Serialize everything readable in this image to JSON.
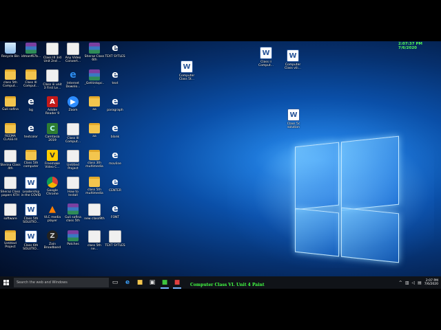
{
  "overlay_clock": "2:07:37 PM 7/6/2020",
  "taskbar": {
    "search_placeholder": "Search the web and Windows",
    "video_title": "Computer Class VI. Unit 4 Paint",
    "clock_time": "2:07 PM",
    "clock_date": "7/6/2020"
  },
  "icons": [
    {
      "label": "Recycle Bin",
      "type": "bin"
    },
    {
      "label": "idmanf67b...",
      "type": "rar"
    },
    {
      "label": "Class III 3rd Unit 2nd ...",
      "type": "file"
    },
    {
      "label": "Any Video Convert...",
      "type": "file"
    },
    {
      "label": "Sheraz Class 6th",
      "type": "rar"
    },
    {
      "label": "TEXT SYTLES",
      "type": "edge"
    },
    {
      "label": "class 5th Comput...",
      "type": "folder"
    },
    {
      "label": "Class III Comput...",
      "type": "folder"
    },
    {
      "label": "Class iii unit 3 First Le...",
      "type": "file"
    },
    {
      "label": "Internet Downlo...",
      "type": "ie"
    },
    {
      "label": "_Gettintopc...",
      "type": "rar"
    },
    {
      "label": "text",
      "type": "edge"
    },
    {
      "label": "Guli safina",
      "type": "folder"
    },
    {
      "label": "bg",
      "type": "edge"
    },
    {
      "label": "Adobe Reader 9",
      "type": "pdf"
    },
    {
      "label": "Zoom",
      "type": "zoom"
    },
    {
      "label": "aa",
      "type": "folder"
    },
    {
      "label": "paragraph",
      "type": "edge"
    },
    {
      "label": "REEMA CLASS III",
      "type": "folder"
    },
    {
      "label": "textcolor",
      "type": "edge"
    },
    {
      "label": "Camtasia 2019",
      "type": "cam"
    },
    {
      "label": "Class III Comput...",
      "type": "file"
    },
    {
      "label": "aa",
      "type": "folder"
    },
    {
      "label": "blank",
      "type": "edge"
    },
    {
      "label": "Sterina Class 4th",
      "type": "file"
    },
    {
      "label": "Class 5th computer",
      "type": "folder"
    },
    {
      "label": "Freemake Video C...",
      "type": "fm"
    },
    {
      "label": "Untitled Project",
      "type": "file"
    },
    {
      "label": "class 3th multimedia",
      "type": "folder"
    },
    {
      "label": "movline",
      "type": "edge"
    },
    {
      "label": "Sheraz Class papers 6TH",
      "type": "file"
    },
    {
      "label": "Leadership in the COVID",
      "type": "word"
    },
    {
      "label": "Google Chrome",
      "type": "chrome"
    },
    {
      "label": "How to Install",
      "type": "file"
    },
    {
      "label": "class 5th multimedia",
      "type": "folder"
    },
    {
      "label": "CENTER",
      "type": "edge"
    },
    {
      "label": "software",
      "type": "file"
    },
    {
      "label": "Class 5th SOLUTIO...",
      "type": "word"
    },
    {
      "label": "VLC media player",
      "type": "vlc"
    },
    {
      "label": "Guli safina class 5th",
      "type": "rar"
    },
    {
      "label": "new class9th",
      "type": "file"
    },
    {
      "label": "FONT",
      "type": "edge"
    },
    {
      "label": "Untitled Project",
      "type": "folder"
    },
    {
      "label": "Class 6th SOLUTIO...",
      "type": "word"
    },
    {
      "label": "Zain Broadband",
      "type": "zain"
    },
    {
      "label": "Patches",
      "type": "rar"
    },
    {
      "label": "class 5th ne...",
      "type": "file"
    },
    {
      "label": "TEXT SYTLES",
      "type": "file"
    }
  ],
  "right_icons": [
    {
      "label": "Computer Class 5t...",
      "type": "word"
    },
    {
      "label": "Class ii Comput...",
      "type": "word"
    },
    {
      "label": "Computer Class viii...",
      "type": "word"
    },
    {
      "label": "Class 5c solution",
      "type": "word"
    }
  ],
  "glyphs": {
    "word": "W",
    "edge": "e",
    "pdf": "A",
    "zoom": "▶",
    "cam": "C",
    "vlc": "▲",
    "ie": "e",
    "fm": "V",
    "zain": "Z",
    "chrome": "",
    "rar": "",
    "file": "",
    "folder": "",
    "bin": ""
  }
}
